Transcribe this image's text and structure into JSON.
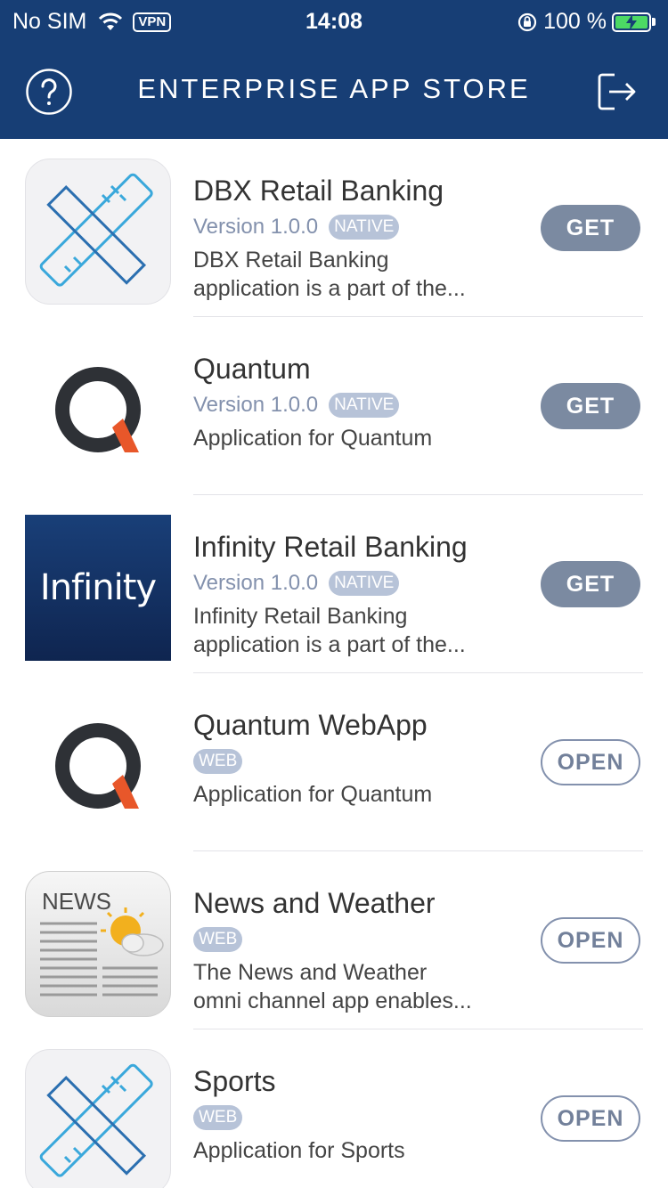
{
  "status_bar": {
    "carrier": "No SIM",
    "vpn": "VPN",
    "time": "14:08",
    "battery_percent": "100 %",
    "battery_color": "#4cd964"
  },
  "nav": {
    "title": "ENTERPRISE APP STORE",
    "left_icon": "help-icon",
    "right_icon": "logout-icon",
    "background": "#173e75"
  },
  "apps": [
    {
      "name": "DBX Retail Banking",
      "version": "Version 1.0.0",
      "type": "NATIVE",
      "desc_line1": "DBX Retail Banking",
      "desc_line2": "application is a part of the...",
      "action": "GET",
      "icon": "tools-icon"
    },
    {
      "name": "Quantum",
      "version": "Version 1.0.0",
      "type": "NATIVE",
      "desc_line1": "Application for Quantum",
      "desc_line2": "",
      "action": "GET",
      "icon": "quantum-logo-icon"
    },
    {
      "name": "Infinity Retail Banking",
      "version": "Version 1.0.0",
      "type": "NATIVE",
      "desc_line1": "Infinity Retail Banking",
      "desc_line2": "application is a part of the...",
      "action": "GET",
      "icon": "infinity-logo-icon",
      "icon_text": "Infinity"
    },
    {
      "name": "Quantum WebApp",
      "version": "",
      "type": "WEB",
      "desc_line1": "Application for Quantum",
      "desc_line2": "",
      "action": "OPEN",
      "icon": "quantum-logo-icon"
    },
    {
      "name": "News and Weather",
      "version": "",
      "type": "WEB",
      "desc_line1": "The News and Weather",
      "desc_line2": "omni channel app enables...",
      "action": "OPEN",
      "icon": "news-weather-icon",
      "icon_text": "NEWS"
    },
    {
      "name": "Sports",
      "version": "",
      "type": "WEB",
      "desc_line1": "Application for Sports",
      "desc_line2": "",
      "action": "OPEN",
      "icon": "tools-icon"
    }
  ]
}
